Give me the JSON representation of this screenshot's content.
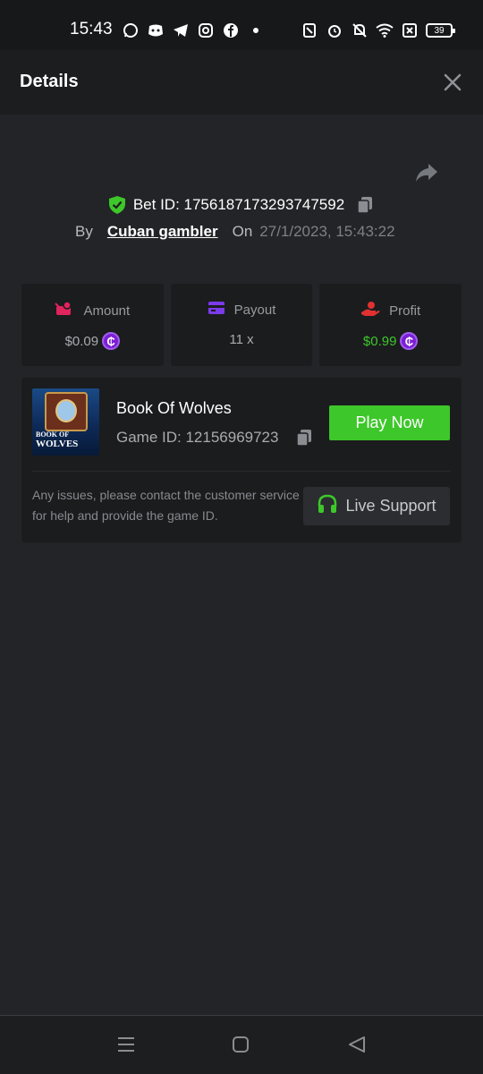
{
  "status_bar": {
    "time": "15:43",
    "battery": "39"
  },
  "header": {
    "title": "Details"
  },
  "bet": {
    "bet_id": "Bet ID: 1756187173293747592",
    "by_label": "By",
    "user": "Cuban gambler",
    "on_label": "On",
    "date": "27/1/2023, 15:43:22"
  },
  "stats": {
    "amount": {
      "label": "Amount",
      "value": "$0.09"
    },
    "payout": {
      "label": "Payout",
      "value": "11 x"
    },
    "profit": {
      "label": "Profit",
      "value": "$0.99"
    }
  },
  "game": {
    "name": "Book Of Wolves",
    "game_id": "Game ID: 12156969723",
    "thumb_title": "BOOK OF WOLVES",
    "play_label": "Play Now",
    "help_text": "Any issues, please contact the customer service for help and provide the game ID.",
    "support_label": "Live Support"
  },
  "colors": {
    "accent_green": "#3dc72a",
    "coin_purple": "#7b1fd6",
    "amount_icon": "#e0245e",
    "payout_icon": "#7c3aed",
    "profit_icon": "#e03131"
  },
  "icons": {
    "coin_symbol": "₵"
  }
}
